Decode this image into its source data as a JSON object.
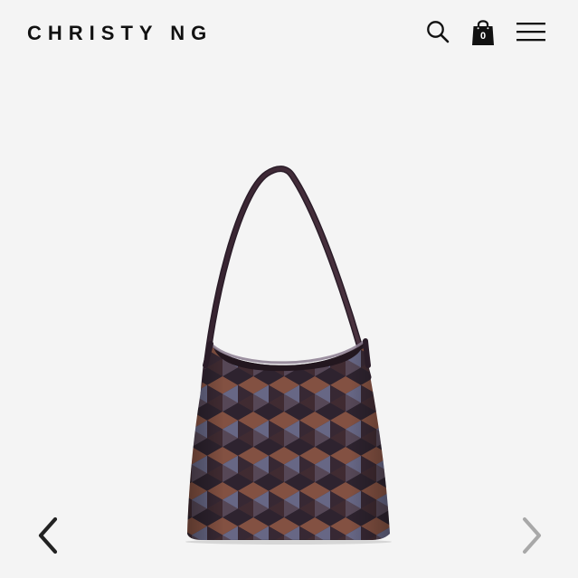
{
  "header": {
    "brand": "CHRISTY NG",
    "icons": {
      "search": "search-icon",
      "bag": "shopping-bag-icon",
      "menu": "hamburger-menu-icon"
    },
    "cart_count": "0"
  },
  "gallery": {
    "previous_icon": "chevron-left-icon",
    "next_icon": "chevron-right-icon",
    "product_image": "shoulder-bag-product-photo"
  },
  "colors": {
    "background": "#f4f4f4",
    "text": "#111111",
    "arrow_active": "#222222",
    "arrow_inactive": "#a8a8a8",
    "bag_primary": "#3d2b3a",
    "bag_secondary": "#7a4a3d",
    "bag_tertiary": "#5c5a7a"
  }
}
